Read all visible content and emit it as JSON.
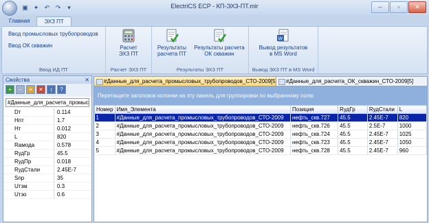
{
  "window": {
    "title": "ElectriCS ECP - КП-ЭХЗ-ПТ.mir"
  },
  "tabs": [
    "Главная",
    "ЭХЗ ПТ"
  ],
  "ribbon": {
    "groups": [
      {
        "label": "Ввод ИД ПТ",
        "links": [
          "Ввод промысловых трубопроводов",
          "Ввод ОК скважин"
        ]
      },
      {
        "label": "Расчет ЭХЗ ПТ",
        "buttons": [
          "Расчет\nЭХЗ ПТ"
        ]
      },
      {
        "label": "Результаты ЭХЗ ПТ",
        "buttons": [
          "Результаты\nрасчета ПТ",
          "Результаты расчета\nОК скважин"
        ]
      },
      {
        "label": "Вывод ЭХЗ ПТ в MS Word",
        "buttons": [
          "Вывод результатов\nв MS Word"
        ]
      }
    ]
  },
  "properties": {
    "title": "Свойства",
    "selected": "#Данные_для_расчета_промысл",
    "rows": [
      {
        "key": "Dт",
        "value": "0.114"
      },
      {
        "key": "Hпт",
        "value": "1.7"
      },
      {
        "key": "Hт",
        "value": "0.012"
      },
      {
        "key": "L",
        "value": "820"
      },
      {
        "key": "Rамода",
        "value": "0.578"
      },
      {
        "key": "RудГр",
        "value": "45.5"
      },
      {
        "key": "RудПр",
        "value": "0.018"
      },
      {
        "key": "RудСтали",
        "value": "2.45E-7"
      },
      {
        "key": "Snp",
        "value": "35"
      },
      {
        "key": "Uтзм",
        "value": "0.3"
      },
      {
        "key": "Uтзо",
        "value": "0.6"
      }
    ]
  },
  "doc_tabs": [
    "#Данные_для_расчета_промысловых_трубопроводов_СТО-2009[5]",
    "#Данные_для_расчета_ОК_скважин_СТО-2009[5]"
  ],
  "grid": {
    "group_hint": "Перетащите заголовок колонки на эту панель для группировки по выбранному полю",
    "columns": [
      "Номер",
      "Имя_Элемента",
      "Позиция",
      "RудГр",
      "RудСтали",
      "L"
    ],
    "rows": [
      [
        "1",
        "#Данные_для_расчета_промысловых_трубопроводов_СТО-2009",
        "нефть_скв.727",
        "45.5",
        "2.45E-7",
        "820"
      ],
      [
        "2",
        "#Данные_для_расчета_промысловых_трубопроводов_СТО-2009",
        "нефть_скв.726",
        "45.5",
        "2.5E-7",
        "1000"
      ],
      [
        "3",
        "#Данные_для_расчета_промысловых_трубопроводов_СТО-2009",
        "нефть_скв.724",
        "45.5",
        "2.45E-7",
        "1025"
      ],
      [
        "4",
        "#Данные_для_расчета_промысловых_трубопроводов_СТО-2009",
        "нефть_скв.723",
        "45.5",
        "2.45E-7",
        "1050"
      ],
      [
        "5",
        "#Данные_для_расчета_промысловых_трубопроводов_СТО-2009",
        "нефть_скв.728",
        "45.5",
        "2.45E-7",
        "960"
      ]
    ]
  }
}
